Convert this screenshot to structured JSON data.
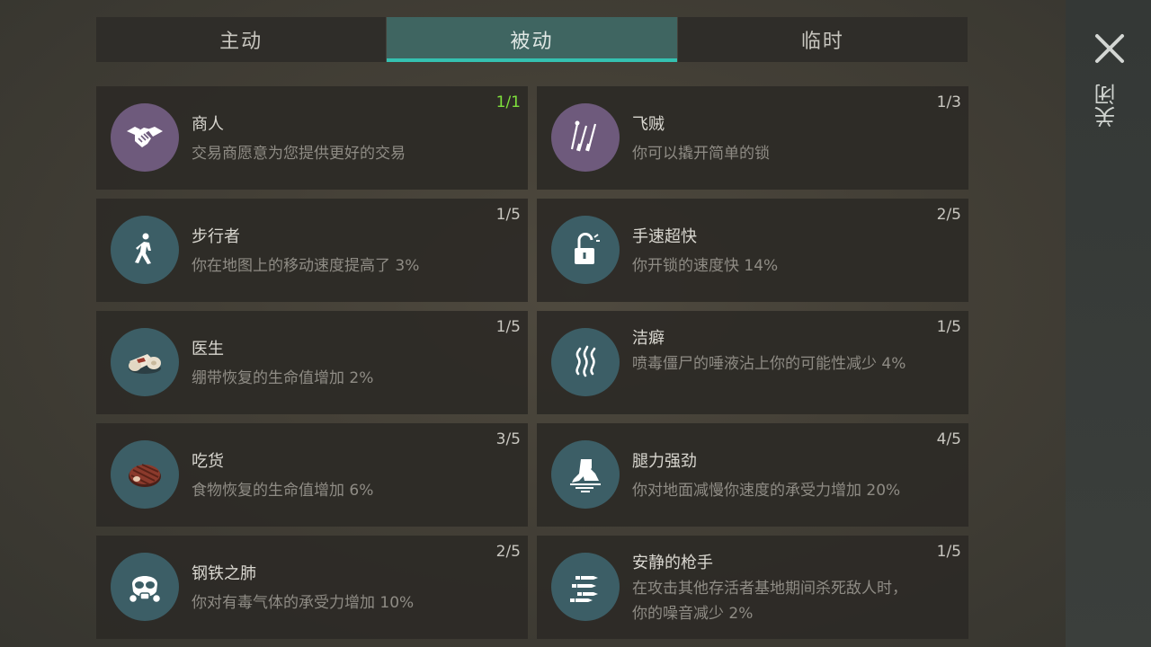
{
  "tabs": [
    {
      "label": "主动",
      "active": false
    },
    {
      "label": "被动",
      "active": true
    },
    {
      "label": "临时",
      "active": false
    }
  ],
  "close": {
    "label": "关闭",
    "icon": "close-icon"
  },
  "colors": {
    "purple_icon_bg": "#6e5a7c",
    "teal_icon_bg": "#3c5e66",
    "accent": "#35c1b1",
    "max_level": "#7ee03c"
  },
  "perks": [
    {
      "title": "商人",
      "desc": "交易商愿意为您提供更好的交易",
      "level": "1/1",
      "icon": "handshake-icon",
      "maxed": true
    },
    {
      "title": "飞贼",
      "desc": "你可以撬开简单的锁",
      "level": "1/3",
      "icon": "lockpick-icon",
      "maxed": false
    },
    {
      "title": "步行者",
      "desc": "你在地图上的移动速度提高了 3%",
      "level": "1/5",
      "icon": "walker-icon",
      "maxed": false
    },
    {
      "title": "手速超快",
      "desc": "你开锁的速度快 14%",
      "level": "2/5",
      "icon": "unlocked-padlock-icon",
      "maxed": false
    },
    {
      "title": "医生",
      "desc": "绷带恢复的生命值增加 2%",
      "level": "1/5",
      "icon": "bandage-icon",
      "maxed": false
    },
    {
      "title": "洁癖",
      "desc": "喷毒僵尸的唾液沾上你的可能性减少 4%",
      "level": "1/5",
      "icon": "toxic-fumes-icon",
      "maxed": false
    },
    {
      "title": "吃货",
      "desc": "食物恢复的生命值增加 6%",
      "level": "3/5",
      "icon": "steak-icon",
      "maxed": false
    },
    {
      "title": "腿力强劲",
      "desc": "你对地面减慢你速度的承受力增加 20%",
      "level": "4/5",
      "icon": "foot-icon",
      "maxed": false
    },
    {
      "title": "钢铁之肺",
      "desc": "你对有毒气体的承受力增加 10%",
      "level": "2/5",
      "icon": "gas-mask-icon",
      "maxed": false
    },
    {
      "title": "安静的枪手",
      "desc": "在攻击其他存活者基地期间杀死敌人时，你的噪音减少 2%",
      "level": "1/5",
      "icon": "bullets-icon",
      "maxed": false
    }
  ]
}
